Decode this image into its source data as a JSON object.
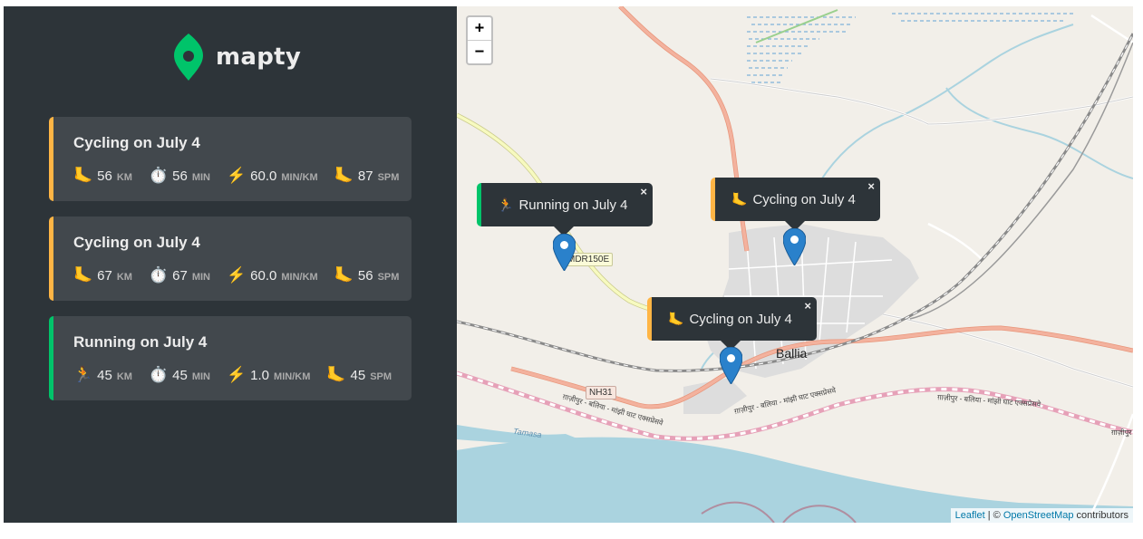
{
  "app": {
    "name": "mapty",
    "brand_color": "#00c46a"
  },
  "workouts": [
    {
      "type": "cycling",
      "title": "Cycling on July 4",
      "accent": "#ffb545",
      "distance": "56",
      "distance_unit": "km",
      "duration": "56",
      "duration_unit": "min",
      "pace": "60.0",
      "pace_unit": "min/km",
      "cadence": "87",
      "cadence_unit": "spm",
      "type_icon": "🦶"
    },
    {
      "type": "cycling",
      "title": "Cycling on July 4",
      "accent": "#ffb545",
      "distance": "67",
      "distance_unit": "km",
      "duration": "67",
      "duration_unit": "min",
      "pace": "60.0",
      "pace_unit": "min/km",
      "cadence": "56",
      "cadence_unit": "spm",
      "type_icon": "🦶"
    },
    {
      "type": "running",
      "title": "Running on July 4",
      "accent": "#00c46a",
      "distance": "45",
      "distance_unit": "km",
      "duration": "45",
      "duration_unit": "min",
      "pace": "1.0",
      "pace_unit": "min/km",
      "cadence": "45",
      "cadence_unit": "spm",
      "type_icon": "🏃"
    }
  ],
  "icons": {
    "duration": "⏱️",
    "pace": "⚡️",
    "cadence": "🦶"
  },
  "map": {
    "zoom_in": "+",
    "zoom_out": "−",
    "popups": [
      {
        "label": "Running on July 4",
        "icon": "🏃",
        "close": "×"
      },
      {
        "label": "Cycling on July 4",
        "icon": "🦶",
        "close": "×"
      },
      {
        "label": "Cycling on July 4",
        "icon": "🦶",
        "close": "×"
      }
    ],
    "labels": {
      "city": "Ballia",
      "road_nh": "NH31",
      "road_mdr": "MDR150E",
      "river": "Tamasa",
      "rail_1": "ग़ाज़ीपुर - बलिया - मांझी घाट एक्सप्रेसवे",
      "rail_2": "ग़ाज़ीपुर - बलिया - मांझी घाट एक्सप्रेसवे",
      "rail_3": "ग़ाज़ीपुर - बलिया - मांझी घाट एक्सप्रेसवे",
      "rail_4": "ग़ाज़ीपुर"
    },
    "attribution": {
      "leaflet": "Leaflet",
      "separator": " | © ",
      "osm": "OpenStreetMap",
      "suffix": " contributors"
    }
  }
}
